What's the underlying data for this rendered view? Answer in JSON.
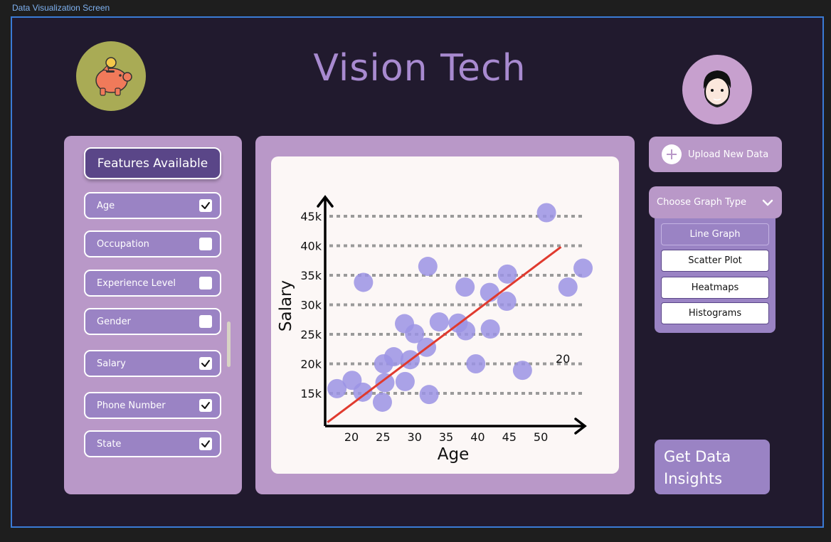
{
  "frame": {
    "label": "Data Visualization Screen"
  },
  "app": {
    "title": "Vision Tech",
    "logo_icon": "piggy-bank-icon",
    "avatar_icon": "user-avatar-icon"
  },
  "features": {
    "header": "Features Available",
    "items": [
      {
        "label": "Age",
        "checked": true
      },
      {
        "label": "Occupation",
        "checked": false
      },
      {
        "label": "Experience Level",
        "checked": false
      },
      {
        "label": "Gender",
        "checked": false
      },
      {
        "label": "Salary",
        "checked": true
      },
      {
        "label": "Phone Number",
        "checked": true
      },
      {
        "label": "State",
        "checked": true
      }
    ]
  },
  "actions": {
    "upload_label": "Upload New Data",
    "graph_type_label": "Choose Graph Type",
    "graph_options": [
      "Line Graph",
      "Scatter Plot",
      "Heatmaps",
      "Histograms"
    ],
    "selected_graph": "Line Graph",
    "insights_label": "Get Data Insights"
  },
  "colors": {
    "background": "#211a2e",
    "panel": "#b998c8",
    "accent": "#5a4688",
    "button": "#9a83c4",
    "point": "#9b93e4",
    "trend_line": "#e03a2e",
    "logo_bg": "#a9ab55",
    "avatar_bg": "#c7a0ce"
  },
  "chart_data": {
    "type": "scatter",
    "xlabel": "Age",
    "ylabel": "Salary",
    "x_ticks": [
      "20",
      "25",
      "30",
      "35",
      "40",
      "45",
      "50"
    ],
    "y_ticks": [
      "15k",
      "20k",
      "25k",
      "30k",
      "35k",
      "40k",
      "45k"
    ],
    "annotation": "20",
    "grid": true,
    "points": [
      {
        "x": 17.7,
        "y": 15.8
      },
      {
        "x": 20.1,
        "y": 17.2
      },
      {
        "x": 21.8,
        "y": 15.2
      },
      {
        "x": 21.9,
        "y": 33.8
      },
      {
        "x": 24.9,
        "y": 13.5
      },
      {
        "x": 25.1,
        "y": 20.0
      },
      {
        "x": 25.3,
        "y": 16.8
      },
      {
        "x": 26.7,
        "y": 21.2
      },
      {
        "x": 28.4,
        "y": 26.8
      },
      {
        "x": 28.5,
        "y": 17.0
      },
      {
        "x": 29.3,
        "y": 20.7
      },
      {
        "x": 30.0,
        "y": 25.1
      },
      {
        "x": 32.1,
        "y": 36.5
      },
      {
        "x": 31.9,
        "y": 22.8
      },
      {
        "x": 32.3,
        "y": 14.8
      },
      {
        "x": 33.9,
        "y": 27.1
      },
      {
        "x": 36.9,
        "y": 26.9
      },
      {
        "x": 38.1,
        "y": 25.6
      },
      {
        "x": 38.0,
        "y": 33.0
      },
      {
        "x": 39.7,
        "y": 20.0
      },
      {
        "x": 41.9,
        "y": 32.1
      },
      {
        "x": 42.0,
        "y": 25.9
      },
      {
        "x": 44.7,
        "y": 35.2
      },
      {
        "x": 44.6,
        "y": 30.6
      },
      {
        "x": 47.1,
        "y": 18.9
      },
      {
        "x": 50.9,
        "y": 45.6
      },
      {
        "x": 54.3,
        "y": 33.0
      },
      {
        "x": 56.7,
        "y": 36.2
      }
    ],
    "trend_line": {
      "x1": 16.2,
      "y1": 10.1,
      "x2": 53.2,
      "y2": 39.8
    }
  }
}
